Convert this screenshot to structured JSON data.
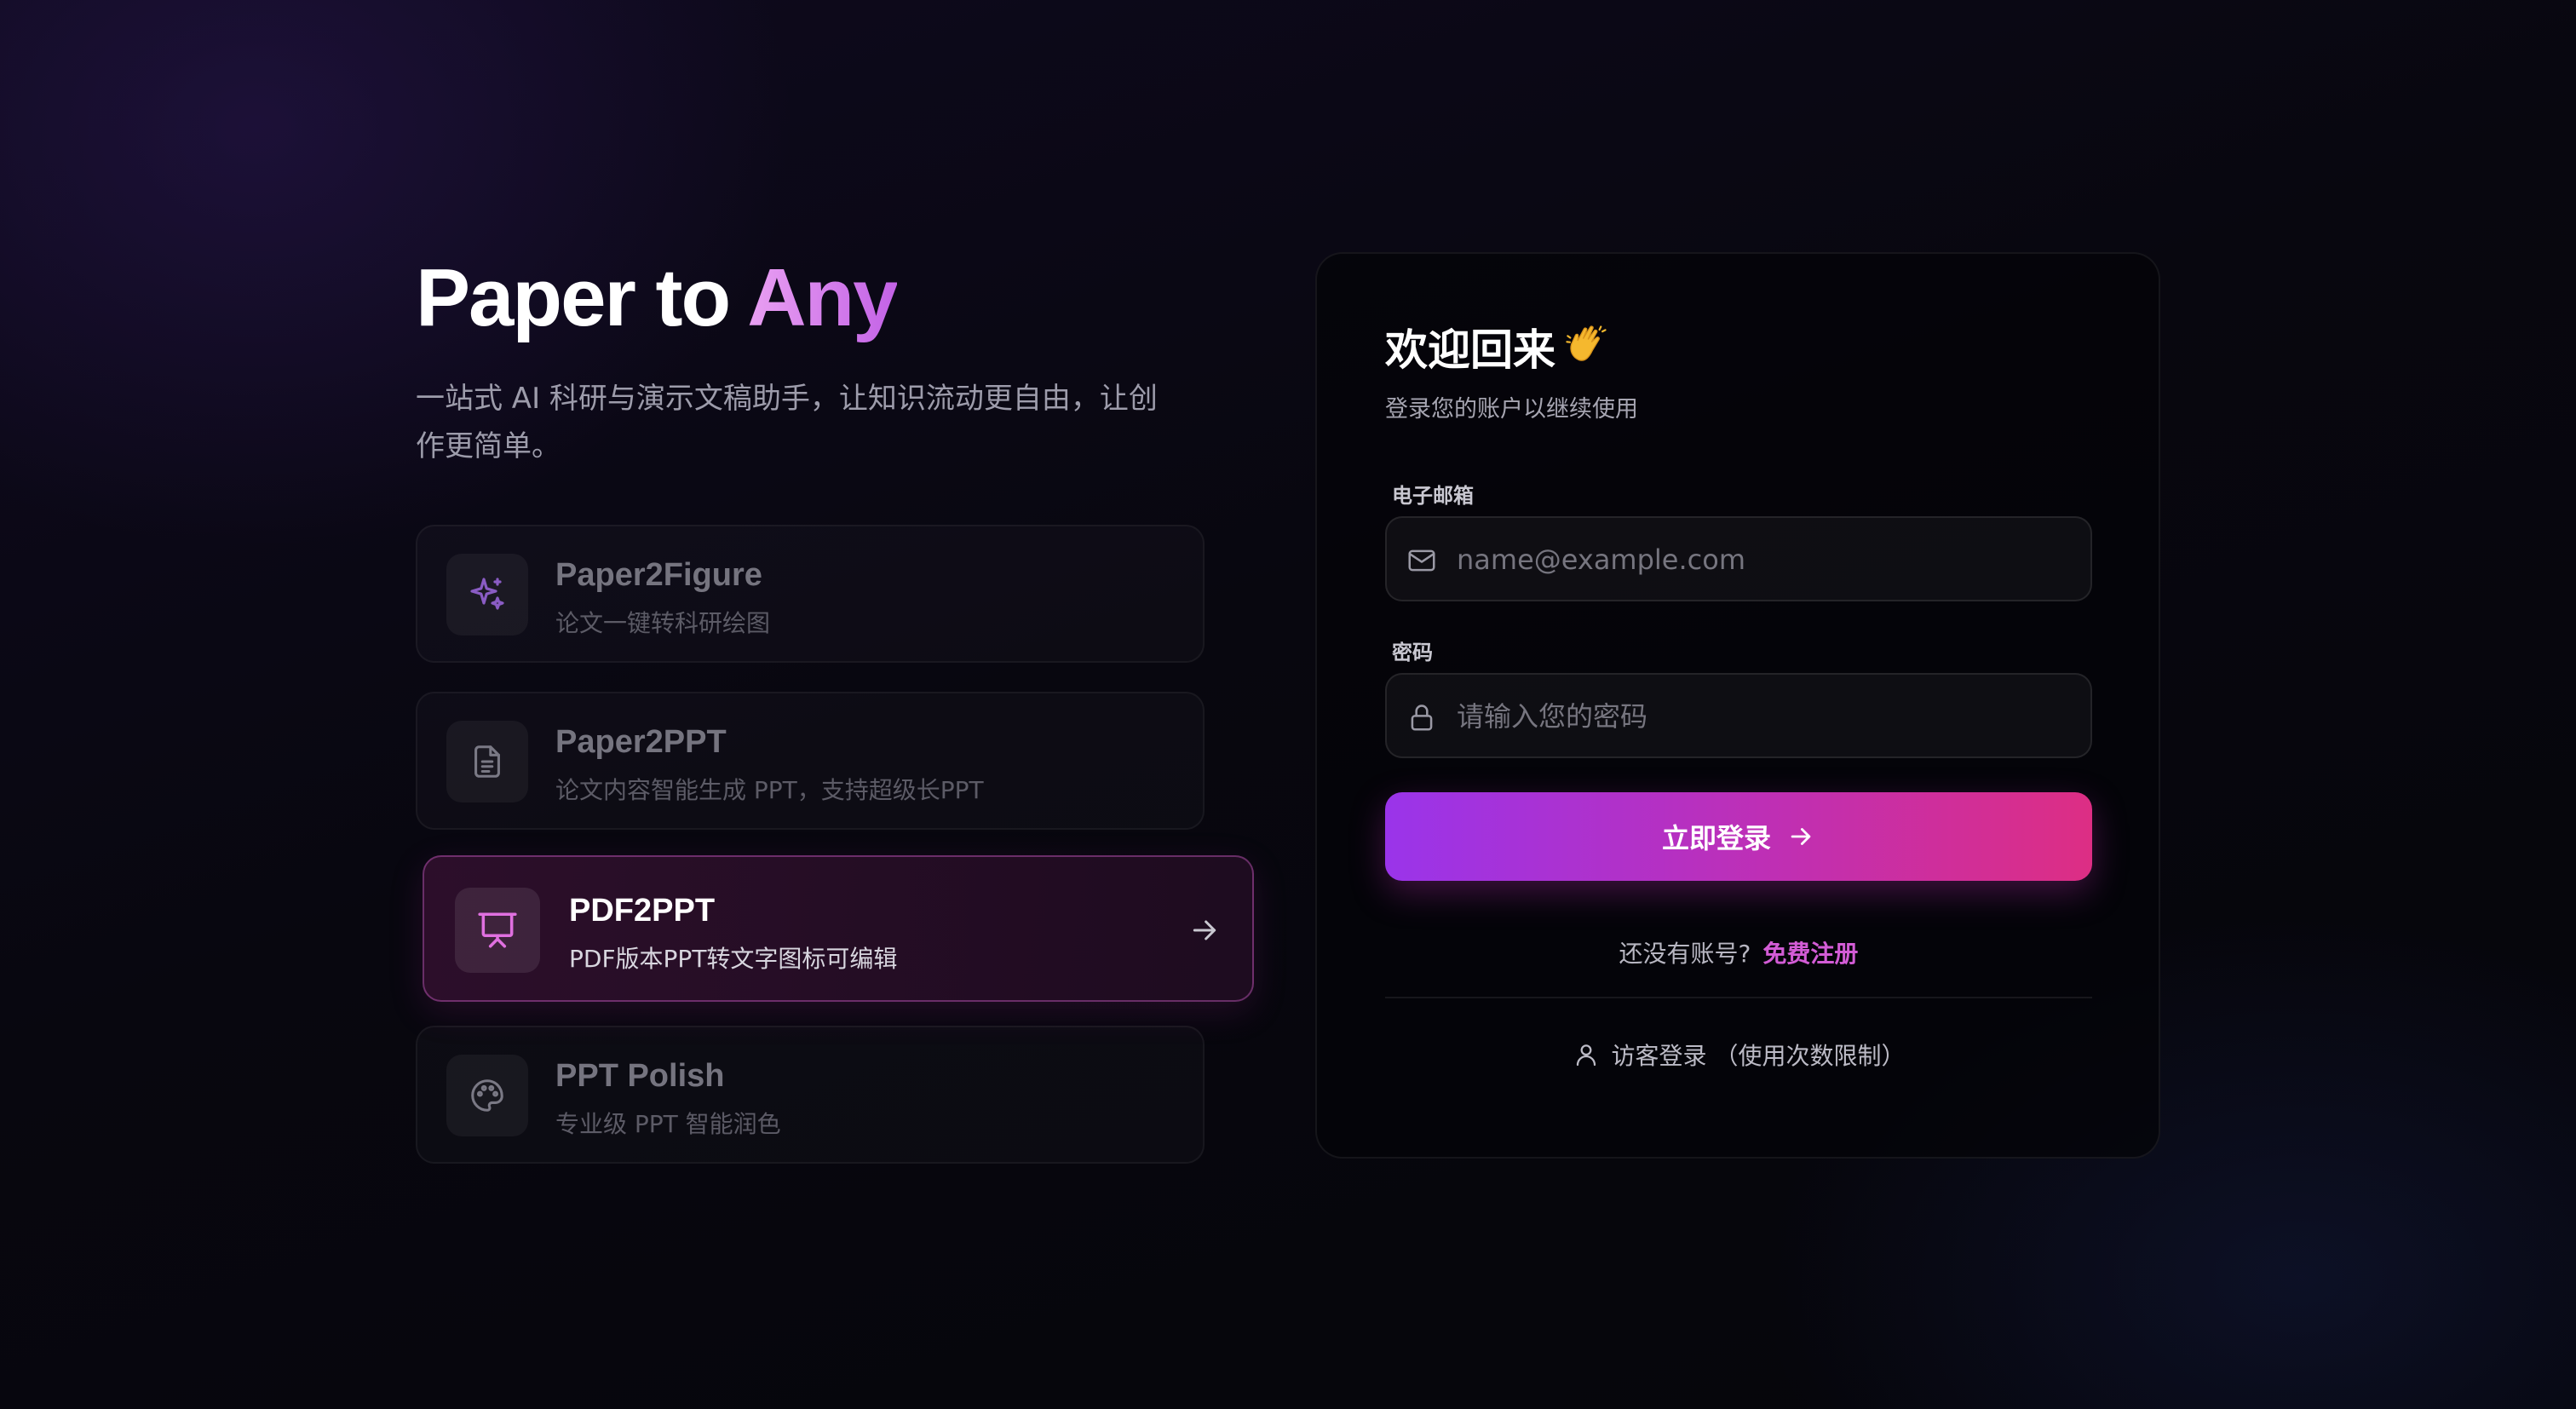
{
  "hero": {
    "title_main": "Paper to ",
    "title_accent": "Any",
    "subtitle": "一站式 AI 科研与演示文稿助手，让知识流动更自由，让创作更简单。"
  },
  "features": [
    {
      "title": "Paper2Figure",
      "description": "论文一键转科研绘图",
      "icon": "sparkles-icon",
      "active": false
    },
    {
      "title": "Paper2PPT",
      "description": "论文内容智能生成 PPT，支持超级长PPT",
      "icon": "document-icon",
      "active": false
    },
    {
      "title": "PDF2PPT",
      "description": "PDF版本PPT转文字图标可编辑",
      "icon": "presentation-icon",
      "active": true
    },
    {
      "title": "PPT Polish",
      "description": "专业级 PPT 智能润色",
      "icon": "palette-icon",
      "active": false
    }
  ],
  "login": {
    "welcome": "欢迎回来",
    "welcome_emoji": "waving-hand-icon",
    "subtitle": "登录您的账户以继续使用",
    "email_label": "电子邮箱",
    "email_placeholder": "name@example.com",
    "email_value": "",
    "password_label": "密码",
    "password_placeholder": "请输入您的密码",
    "password_value": "",
    "submit_label": "立即登录",
    "no_account_text": "还没有账号?",
    "signup_link": "免费注册",
    "guest_login": "访客登录 （使用次数限制）"
  },
  "colors": {
    "accent_pink": "#d35cd6",
    "button_gradient_start": "#9a34ea",
    "button_gradient_end": "#dd2e84",
    "active_border": "#c458be",
    "background": "#08070f"
  }
}
